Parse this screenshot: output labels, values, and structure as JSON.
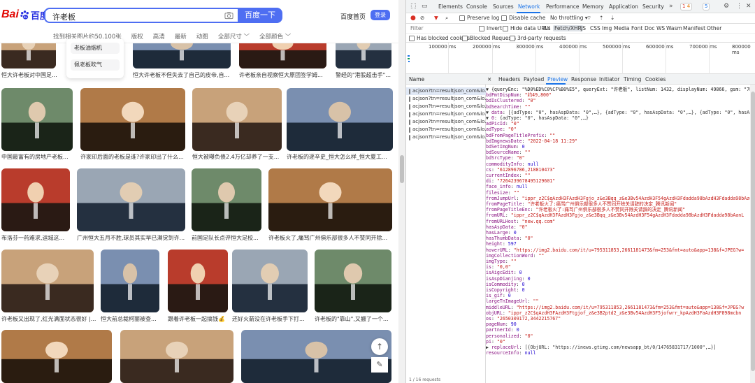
{
  "baidu": {
    "logo_bai": "Bai",
    "logo_du": "百度",
    "search_query": "许老板",
    "search_button": "百度一下",
    "home_link": "百度首页",
    "login_button": "登录",
    "filters": [
      "找到相关图片约50,100张",
      "版权",
      "高清",
      "最新",
      "动图",
      "全部尺寸 ﹀",
      "全部颜色 ﹀"
    ],
    "dropdown": [
      "老板油烟机",
      "佩老板吹气"
    ],
    "rows": [
      [
        "恒大许老板对中国足...",
        "恒大许老板不但失去了自己的皮帝,自...",
        "许老板亲自视察恒大原团签学姆...",
        "警经的\"港股超击手\"..."
      ],
      [
        "中国最富有的房地产老板...",
        "许家印后面的老板是谁?许家印出了什么...",
        "恒大被曝负债2.4万亿却养了一支...",
        "许老板的逐辛史_恒大怎么样_恒大夏工..."
      ],
      [
        "布洛芬一药难求,运城这...",
        "广州恒大五月不胜,球员其实早已满觉到许...",
        "前国足队长点评恒大足校...",
        "许老板火了,痛骂广州俱乐部很多人不赞同开除..."
      ],
      [
        "许老板又出现了,红光满面状态很好 |...",
        "恒大前总裁柯丽被查...",
        "跟着许老板一起搞钱💰",
        "还好火箭没在许老板手下打...",
        "许老板的\"靠山\",又搬了一个..."
      ]
    ],
    "scroll_top": "↑",
    "edit": "✎"
  },
  "devtools": {
    "tabs": [
      "Elements",
      "Console",
      "Sources",
      "Network",
      "Performance",
      "Memory",
      "Application",
      "Security"
    ],
    "active_tab": "Network",
    "badges": {
      "errors": "1",
      "warnings": "4",
      "issues": "5"
    },
    "toolbar": {
      "preserve_log": "Preserve log",
      "disable_cache": "Disable cache",
      "throttling": "No throttling"
    },
    "filter_label": "Filter",
    "filter_options": [
      "Invert",
      "Hide data URLs",
      "All",
      "Fetch/XHR",
      "JS",
      "CSS",
      "Img",
      "Media",
      "Font",
      "Doc",
      "WS",
      "Wasm",
      "Manifest",
      "Other"
    ],
    "filter_options2": [
      "Has blocked cookies",
      "Blocked Requests",
      "3rd-party requests"
    ],
    "timeline_labels": [
      "100000 ms",
      "200000 ms",
      "300000 ms",
      "400000 ms",
      "500000 ms",
      "600000 ms",
      "700000 ms",
      "800000 ms"
    ],
    "list_header": "Name",
    "requests": [
      "acjson?tn=resultjson_com&lo...",
      "acjson?tn=resultjson_com&lo...",
      "acjson?tn=resultjson_com&lo...",
      "acjson?tn=resultjson_com&lo...",
      "acjson?tn=resultjson_com&lo...",
      "acjson?tn=resultjson_com&lo...",
      "acjson?tn=resultjson_com&lo..."
    ],
    "detail_tabs": [
      "Headers",
      "Payload",
      "Preview",
      "Response",
      "Initiator",
      "Timing",
      "Cookies"
    ],
    "active_detail_tab": "Preview",
    "preview_lines": [
      "▼ {queryEnc: \"%D0%ED%C0%CF%B0%E5\", queryExt: \"许老板\", listNum: 1432, displayNum: 49866, gsm: \"78\",…}",
      "    bdFmtDispNum: \"约49,800\"",
      "    bdIsClustered: \"0\"",
      "    bdSearchTime: \"\"",
      "  ▼ data: [{adType: \"0\", hasAspData: \"0\",…}, {adType: \"0\", hasAspData: \"0\",…}, {adType: \"0\", hasAspData: \"0\",…}",
      "    ▼ 0: {adType: \"0\", hasAspData: \"0\",…}",
      "        adPicId: \"0\"",
      "        adType: \"0\"",
      "        bdFromPageTitlePrefix: \"\"",
      "        bdImgnewsDate: \"2022-04-18 11:29\"",
      "        bdSetImgNum: 0",
      "        bdSourceName: \"\"",
      "        bdSrcType: \"0\"",
      "        commodityInfo: null",
      "        cs: \"612896786,218810473\"",
      "        currentIndex: \"\"",
      "        di: \"7264239678495129601\"",
      "        face_info: null",
      "        filesize: \"\"",
      "        fromJumpUrl: \"ippr_z2C$qAzdH3FAzdH3Fgjo_z&e3Bqq_z&e3Bv54AzdH3F54gAzdH3Fdadda98bAzdH3Fdadda98bAzd",
      "        fromPageTitle: \"许老板火了:痛骂广州俱乐部很多人不赞同开除关请辞的决定_腾讯新闻\"",
      "        fromPageTitleEnc: \"许老板火了:痛骂广州俱乐部很多人不赞同开除关请辞的决定_腾讯新闻\"",
      "        fromURL: \"ippr_z2C$qAzdH3FAzdH3Fgjo_z&e3Bqq_z&e3Bv54AzdH3F54gAzdH3Fdadda98bAzdH3Fdadda98bAanL",
      "        fromURLHost: \"new.qq.com\"",
      "        hasAspData: \"0\"",
      "        hasLarge: 0",
      "        hasThumbData: \"0\"",
      "        height: 597",
      "        hoverURL: \"https://img2.baidu.com/it/u=795311853,2661181473&fm=253&fmt=auto&app=138&f=JPEG?w=",
      "        imgCollectionWord: \"\"",
      "        imgType: \"\"",
      "        is: \"0,0\"",
      "        isAigcEdit: 0",
      "        isAspDianjing: 0",
      "        isCommodity: 0",
      "        isCopyright: 0",
      "        is_gif: 0",
      "        largeTnImageUrl: \"\"",
      "        middleURL: \"https://img2.baidu.com/it/u=795311853,2661181473&fm=253&fmt=auto&app=138&f=JPEG?w",
      "        objURL: \"ippr_z2C$qAzdH3FAzdH3Ftgjof_z&e3B2ptd2_z&e3Bv54AzdH3F5jofwrr_kpAzdH3FaAzdH3F898mcbn",
      "        os: \"2650309172,3442215767\"",
      "        pageNum: 90",
      "        partnerId: 0",
      "        personalized: \"0\"",
      "        pi: \"0\"",
      "      ▶ replaceUrl: [{ObjURL: \"https://inews.gtimg.com/newsapp_bt/0/14765831717/1000\",…}]",
      "        resourceInfo: null"
    ],
    "status": "1 / 16 requests"
  }
}
